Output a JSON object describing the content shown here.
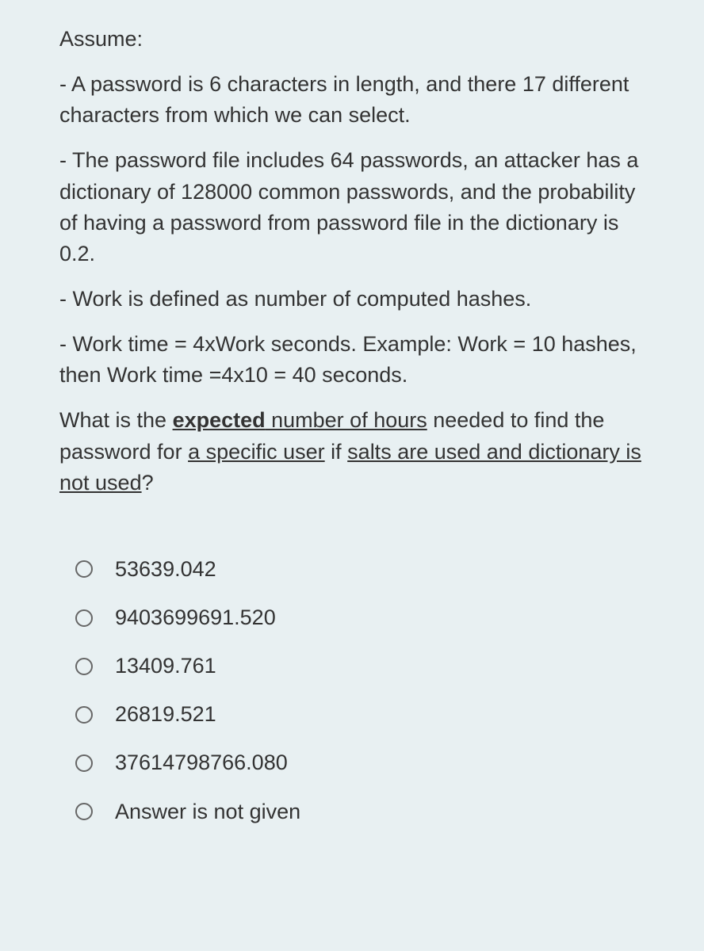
{
  "heading": "Assume:",
  "para1": "- A password is 6 characters in length, and there 17 different characters from which we can select.",
  "para2": "- The password file includes 64 passwords, an attacker has a dictionary of 128000 common passwords, and the probability of having a password from password file in the dictionary is 0.2.",
  "para3": "- Work is defined as number of computed hashes.",
  "para4": "- Work time = 4xWork seconds. Example: Work = 10 hashes, then Work time =4x10 = 40 seconds.",
  "question": {
    "prefix": "What is the ",
    "seg1": "expected",
    "seg2": " number of hours",
    "mid": " needed to find the password for ",
    "seg3": "a specific user",
    "mid2": " if ",
    "seg4": "salts are used and dictionary is not used",
    "suffix": "?"
  },
  "options": [
    "53639.042",
    "9403699691.520",
    "13409.761",
    "26819.521",
    "37614798766.080",
    "Answer is not given"
  ]
}
